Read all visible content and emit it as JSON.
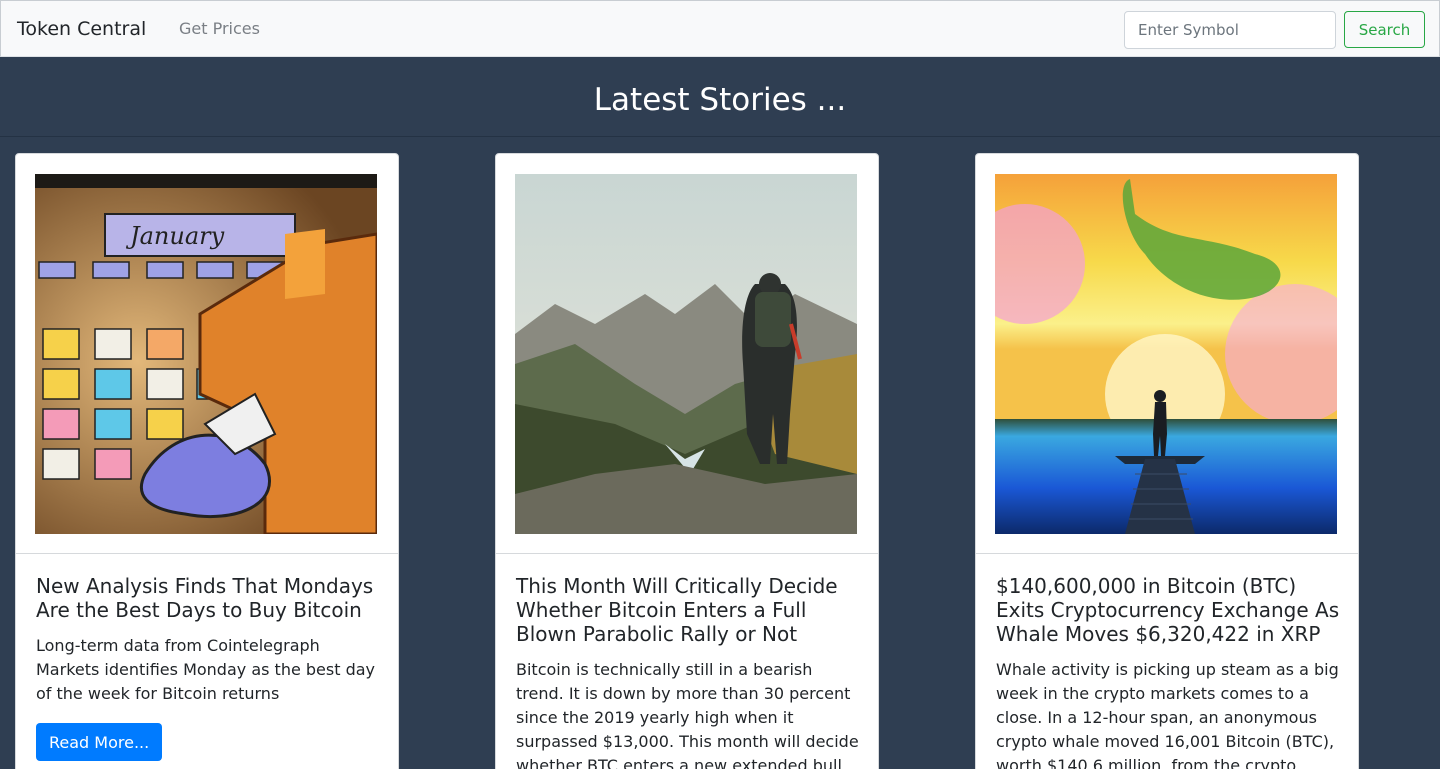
{
  "navbar": {
    "brand": "Token Central",
    "get_prices": "Get Prices",
    "search_placeholder": "Enter Symbol",
    "search_label": "Search"
  },
  "header": {
    "title": "Latest Stories ..."
  },
  "stories": [
    {
      "title": "New Analysis Finds That Mondays Are the Best Days to Buy Bitcoin",
      "text": "Long-term data from Cointelegraph Markets identifies Monday as the best day of the week for Bitcoin returns",
      "button": "Read More...",
      "image_label": "January"
    },
    {
      "title": "This Month Will Critically Decide Whether Bitcoin Enters a Full Blown Parabolic Rally or Not",
      "text": "Bitcoin is technically still in a bearish trend. It is down by more than 30 percent since the 2019 yearly high when it surpassed $13,000. This month will decide whether BTC enters a new extended bull"
    },
    {
      "title": "$140,600,000 in Bitcoin (BTC) Exits Cryptocurrency Exchange As Whale Moves $6,320,422 in XRP",
      "text": "Whale activity is picking up steam as a big week in the crypto markets comes to a close. In a 12-hour span, an anonymous crypto whale moved 16,001 Bitcoin (BTC), worth $140.6 million, from the crypto"
    }
  ]
}
